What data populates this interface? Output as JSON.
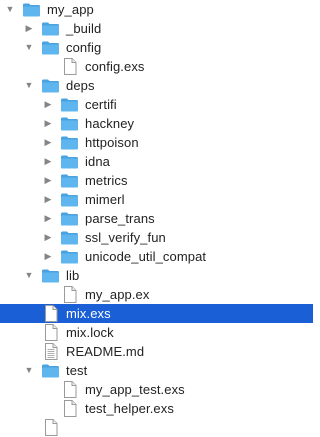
{
  "colors": {
    "folder_body": "#5fb5ee",
    "folder_tab": "#4aa2e0",
    "selection": "#1a5fd6",
    "text": "#222222",
    "disclosure": "#858585"
  },
  "tree": {
    "rows": [
      {
        "label": "my_app",
        "type": "folder",
        "expanded": true,
        "depth": 0,
        "icon": "folder-icon",
        "selected": false
      },
      {
        "label": "_build",
        "type": "folder",
        "expanded": false,
        "depth": 1,
        "icon": "folder-icon",
        "selected": false
      },
      {
        "label": "config",
        "type": "folder",
        "expanded": true,
        "depth": 1,
        "icon": "folder-icon",
        "selected": false
      },
      {
        "label": "config.exs",
        "type": "file",
        "depth": 2,
        "icon": "file-icon",
        "selected": false
      },
      {
        "label": "deps",
        "type": "folder",
        "expanded": true,
        "depth": 1,
        "icon": "folder-icon",
        "selected": false
      },
      {
        "label": "certifi",
        "type": "folder",
        "expanded": false,
        "depth": 2,
        "icon": "folder-icon",
        "selected": false
      },
      {
        "label": "hackney",
        "type": "folder",
        "expanded": false,
        "depth": 2,
        "icon": "folder-icon",
        "selected": false
      },
      {
        "label": "httpoison",
        "type": "folder",
        "expanded": false,
        "depth": 2,
        "icon": "folder-icon",
        "selected": false
      },
      {
        "label": "idna",
        "type": "folder",
        "expanded": false,
        "depth": 2,
        "icon": "folder-icon",
        "selected": false
      },
      {
        "label": "metrics",
        "type": "folder",
        "expanded": false,
        "depth": 2,
        "icon": "folder-icon",
        "selected": false
      },
      {
        "label": "mimerl",
        "type": "folder",
        "expanded": false,
        "depth": 2,
        "icon": "folder-icon",
        "selected": false
      },
      {
        "label": "parse_trans",
        "type": "folder",
        "expanded": false,
        "depth": 2,
        "icon": "folder-icon",
        "selected": false
      },
      {
        "label": "ssl_verify_fun",
        "type": "folder",
        "expanded": false,
        "depth": 2,
        "icon": "folder-icon",
        "selected": false
      },
      {
        "label": "unicode_util_compat",
        "type": "folder",
        "expanded": false,
        "depth": 2,
        "icon": "folder-icon",
        "selected": false
      },
      {
        "label": "lib",
        "type": "folder",
        "expanded": true,
        "depth": 1,
        "icon": "folder-icon",
        "selected": false
      },
      {
        "label": "my_app.ex",
        "type": "file",
        "depth": 2,
        "icon": "file-icon",
        "selected": false
      },
      {
        "label": "mix.exs",
        "type": "file",
        "depth": 1,
        "icon": "file-icon",
        "selected": true
      },
      {
        "label": "mix.lock",
        "type": "file",
        "depth": 1,
        "icon": "file-icon",
        "selected": false
      },
      {
        "label": "README.md",
        "type": "file",
        "depth": 1,
        "icon": "text-file-icon",
        "selected": false
      },
      {
        "label": "test",
        "type": "folder",
        "expanded": true,
        "depth": 1,
        "icon": "folder-icon",
        "selected": false
      },
      {
        "label": "my_app_test.exs",
        "type": "file",
        "depth": 2,
        "icon": "file-icon",
        "selected": false
      },
      {
        "label": "test_helper.exs",
        "type": "file",
        "depth": 2,
        "icon": "file-icon",
        "selected": false
      }
    ]
  }
}
